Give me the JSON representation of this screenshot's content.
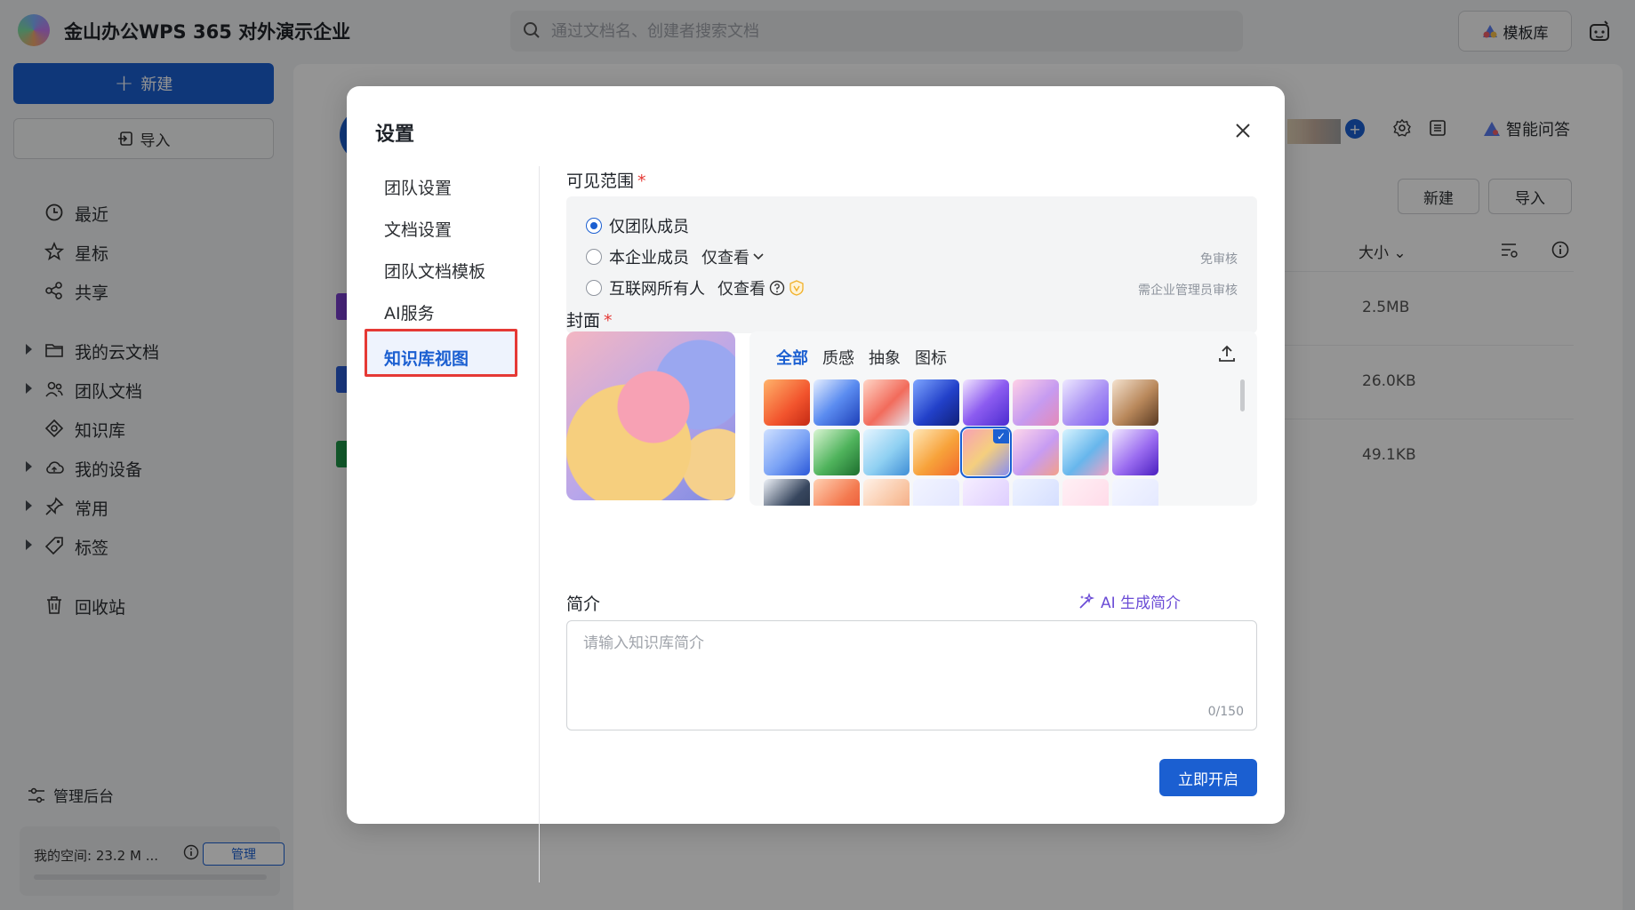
{
  "app": {
    "title": "金山办公WPS 365 对外演示企业"
  },
  "search": {
    "placeholder": "通过文档名、创建者搜索文档"
  },
  "topbar": {
    "template_label": "模板库"
  },
  "sidebar": {
    "new_label": "新建",
    "import_label": "导入",
    "items": [
      {
        "label": "最近",
        "icon": "clock-icon",
        "expandable": false
      },
      {
        "label": "星标",
        "icon": "star-icon",
        "expandable": false
      },
      {
        "label": "共享",
        "icon": "share-icon",
        "expandable": false
      },
      {
        "label": "我的云文档",
        "icon": "folder-icon",
        "expandable": true
      },
      {
        "label": "团队文档",
        "icon": "team-icon",
        "expandable": true
      },
      {
        "label": "知识库",
        "icon": "knowledge-icon",
        "expandable": false
      },
      {
        "label": "我的设备",
        "icon": "device-icon",
        "expandable": true
      },
      {
        "label": "常用",
        "icon": "pin-icon",
        "expandable": true
      },
      {
        "label": "标签",
        "icon": "tag-icon",
        "expandable": true
      },
      {
        "label": "回收站",
        "icon": "trash-icon",
        "expandable": false
      }
    ],
    "admin_label": "管理后台",
    "space_text": "我的空间: 23.2 M ...",
    "manage_label": "管理"
  },
  "main": {
    "smart_ask_label": "智能问答",
    "new_label": "新建",
    "import_label": "导入",
    "size_header": "大小",
    "file_sizes": [
      "2.5MB",
      "26.0KB",
      "49.1KB"
    ]
  },
  "modal": {
    "title": "设置",
    "nav": [
      "团队设置",
      "文档设置",
      "团队文档模板",
      "AI服务",
      "知识库视图"
    ],
    "active_nav": "知识库视图",
    "visibility": {
      "label": "可见范围",
      "required_mark": "*",
      "options": [
        {
          "label": "仅团队成员",
          "selected": true,
          "permission": "",
          "note": ""
        },
        {
          "label": "本企业成员",
          "selected": false,
          "permission": "仅查看",
          "note": "免审核"
        },
        {
          "label": "互联网所有人",
          "selected": false,
          "permission": "仅查看",
          "note": "需企业管理员审核"
        }
      ]
    },
    "cover": {
      "label": "封面",
      "required_mark": "*",
      "tabs": [
        "全部",
        "质感",
        "抽象",
        "图标"
      ],
      "active_tab": "全部",
      "selected_index": 12
    },
    "intro": {
      "label": "简介",
      "ai_label": "AI 生成简介",
      "placeholder": "请输入知识库简介",
      "counter": "0/150"
    },
    "submit_label": "立即开启"
  },
  "colors": {
    "accent": "#1b5fd1",
    "highlight": "#e53935",
    "ai": "#6b4cd6"
  }
}
